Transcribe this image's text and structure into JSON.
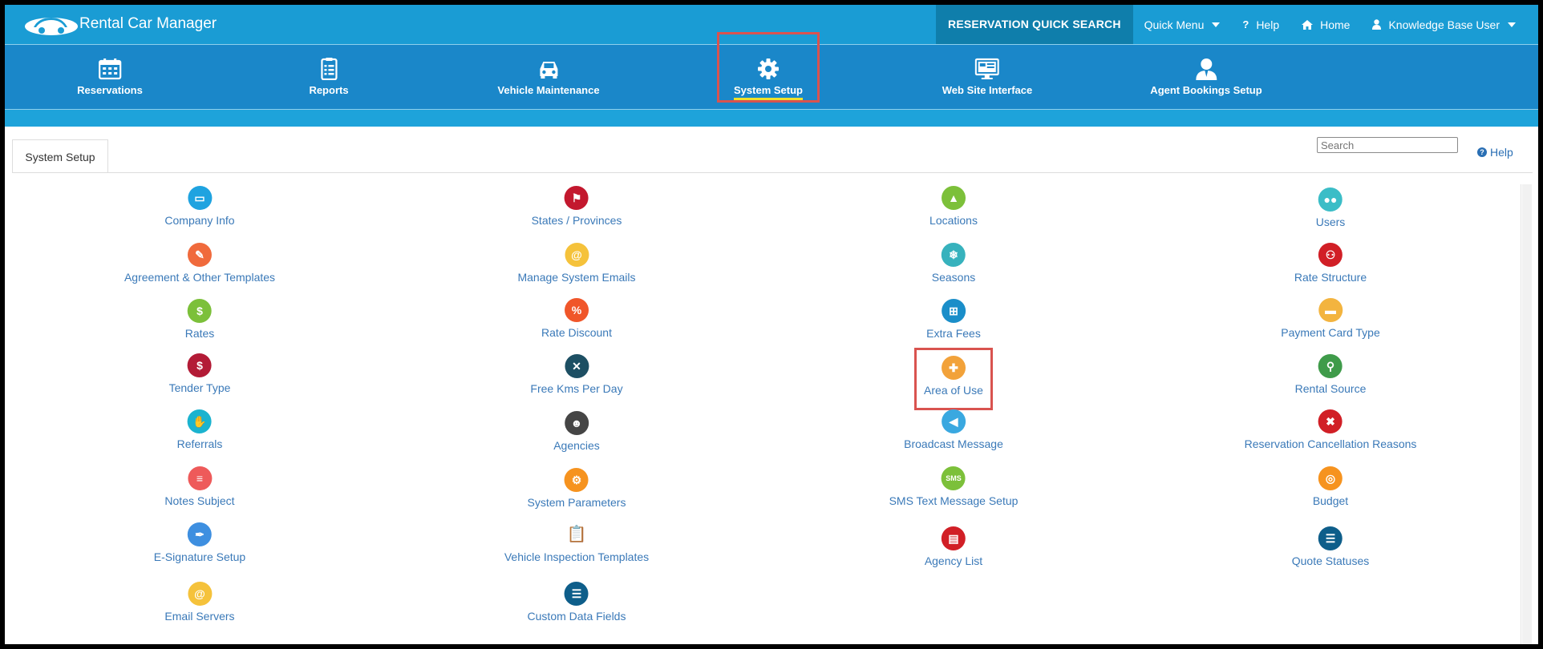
{
  "header": {
    "app_title": "Rental Car Manager",
    "quick_search_label": "RESERVATION QUICK SEARCH",
    "quick_menu_label": "Quick Menu",
    "help_label": "Help",
    "home_label": "Home",
    "user_label": "Knowledge Base User"
  },
  "nav": {
    "items": [
      {
        "label": "Reservations",
        "icon": "calendar-icon"
      },
      {
        "label": "Reports",
        "icon": "clipboard-list-icon"
      },
      {
        "label": "Vehicle Maintenance",
        "icon": "car-icon"
      },
      {
        "label": "System Setup",
        "icon": "gear-icon",
        "active": true
      },
      {
        "label": "Web Site Interface",
        "icon": "monitor-icon"
      },
      {
        "label": "Agent Bookings Setup",
        "icon": "agent-user-icon"
      }
    ]
  },
  "tab": {
    "label": "System Setup"
  },
  "search": {
    "placeholder": "Search"
  },
  "help_link": {
    "label": "Help"
  },
  "setup": {
    "col1": [
      {
        "label": "Company Info",
        "icon": "folder-icon",
        "color": "#1fa3e0"
      },
      {
        "label": "Agreement & Other Templates",
        "icon": "template-edit-icon",
        "color": "#f06a3c"
      },
      {
        "label": "Rates",
        "icon": "rates-money-icon",
        "color": "#7cc03a"
      },
      {
        "label": "Tender Type",
        "icon": "money-bag-icon",
        "color": "#b31b36"
      },
      {
        "label": "Referrals",
        "icon": "hand-coin-icon",
        "color": "#1bb3cf"
      },
      {
        "label": "Notes Subject",
        "icon": "notes-icon",
        "color": "#ee5a5a"
      },
      {
        "label": "E-Signature Setup",
        "icon": "signature-pen-icon",
        "color": "#3e8fe0"
      },
      {
        "label": "Email Servers",
        "icon": "at-sign-icon",
        "color": "#f5c23b"
      }
    ],
    "col2": [
      {
        "label": "States / Provinces",
        "icon": "flag-icon",
        "color": "#c3182e"
      },
      {
        "label": "Manage System Emails",
        "icon": "at-sign-icon",
        "color": "#f5c23b"
      },
      {
        "label": "Rate Discount",
        "icon": "percent-icon",
        "color": "#f0562a"
      },
      {
        "label": "Free Kms Per Day",
        "icon": "road-icon",
        "color": "#1d4f63"
      },
      {
        "label": "Agencies",
        "icon": "people-icon",
        "color": "#454545"
      },
      {
        "label": "System Parameters",
        "icon": "gears-icon",
        "color": "#f6931f"
      },
      {
        "label": "Vehicle Inspection Templates",
        "icon": "clipboard-pencil-icon",
        "color": "#ffffff"
      },
      {
        "label": "Custom Data Fields",
        "icon": "list-icon",
        "color": "#0e5e8a"
      }
    ],
    "col3": [
      {
        "label": "Locations",
        "icon": "map-location-icon",
        "color": "#7cc03a"
      },
      {
        "label": "Seasons",
        "icon": "snowflake-icon",
        "color": "#37b2bd"
      },
      {
        "label": "Extra Fees",
        "icon": "grid-icon",
        "color": "#1a8ec9"
      },
      {
        "label": "Area of Use",
        "icon": "signpost-icon",
        "color": "#f2a23a"
      },
      {
        "label": "Broadcast Message",
        "icon": "megaphone-icon",
        "color": "#3aa8e0"
      },
      {
        "label": "SMS Text Message Setup",
        "icon": "sms-icon",
        "color": "#7cc03a"
      },
      {
        "label": "Agency List",
        "icon": "document-list-icon",
        "color": "#d11f26"
      }
    ],
    "col4": [
      {
        "label": "Users",
        "icon": "users-icon",
        "color": "#3bbdc7"
      },
      {
        "label": "Rate Structure",
        "icon": "structure-icon",
        "color": "#d11f26"
      },
      {
        "label": "Payment Card Type",
        "icon": "credit-card-icon",
        "color": "#f3b43f"
      },
      {
        "label": "Rental Source",
        "icon": "magnifier-icon",
        "color": "#3f9b4a"
      },
      {
        "label": "Reservation Cancellation Reasons",
        "icon": "cancel-x-icon",
        "color": "#d11f26"
      },
      {
        "label": "Budget",
        "icon": "target-icon",
        "color": "#f6931f"
      },
      {
        "label": "Quote Statuses",
        "icon": "list-icon",
        "color": "#0e5e8a"
      }
    ]
  }
}
